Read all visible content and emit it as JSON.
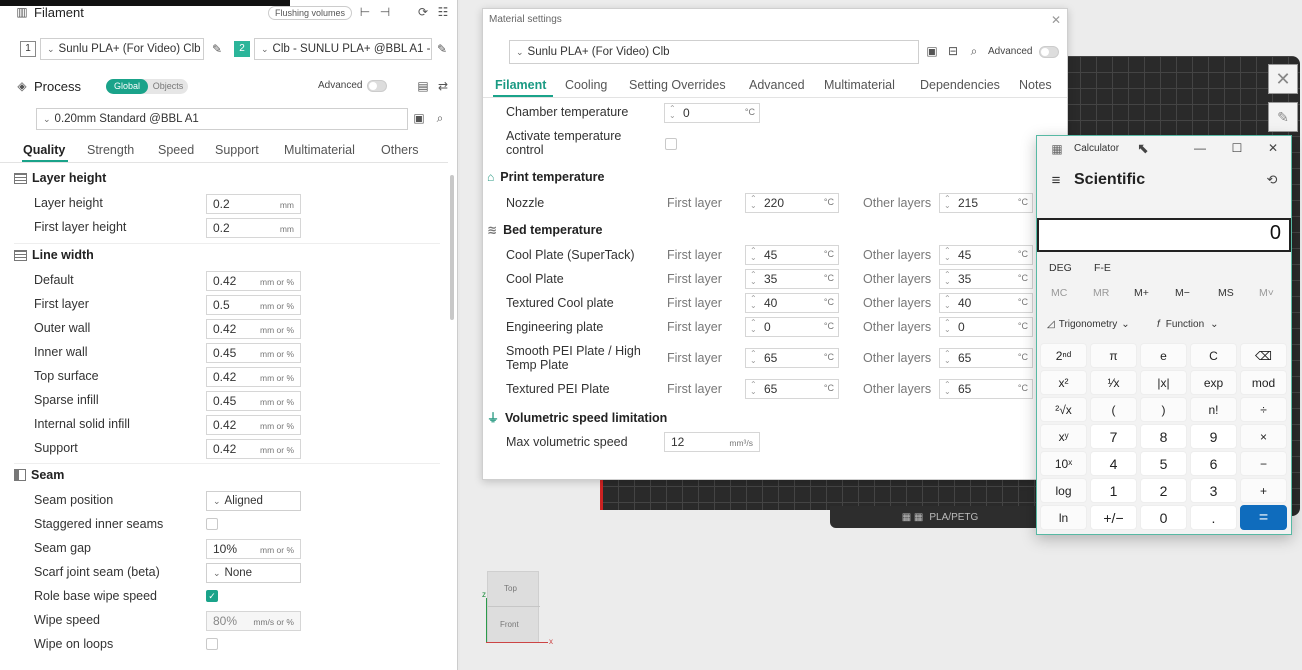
{
  "left": {
    "filament_title": "Filament",
    "flushing_volumes": "Flushing volumes",
    "filament1_index": "1",
    "filament1_name": "Sunlu PLA+ (For Video) Clb",
    "filament2_index": "2",
    "filament2_name": "Clb - SUNLU PLA+ @BBL A1 - ...",
    "process_title": "Process",
    "seg_global": "Global",
    "seg_objects": "Objects",
    "advanced": "Advanced",
    "preset": "0.20mm Standard @BBL A1",
    "tabs": [
      "Quality",
      "Strength",
      "Speed",
      "Support",
      "Multimaterial",
      "Others"
    ],
    "sections": {
      "layer_height": "Layer height",
      "line_width": "Line width",
      "seam": "Seam"
    },
    "layer_rows": [
      {
        "label": "Layer height",
        "value": "0.2",
        "unit": "mm"
      },
      {
        "label": "First layer height",
        "value": "0.2",
        "unit": "mm"
      }
    ],
    "line_rows": [
      {
        "label": "Default",
        "value": "0.42",
        "unit": "mm or %"
      },
      {
        "label": "First layer",
        "value": "0.5",
        "unit": "mm or %"
      },
      {
        "label": "Outer wall",
        "value": "0.42",
        "unit": "mm or %"
      },
      {
        "label": "Inner wall",
        "value": "0.45",
        "unit": "mm or %"
      },
      {
        "label": "Top surface",
        "value": "0.42",
        "unit": "mm or %"
      },
      {
        "label": "Sparse infill",
        "value": "0.45",
        "unit": "mm or %"
      },
      {
        "label": "Internal solid infill",
        "value": "0.42",
        "unit": "mm or %"
      },
      {
        "label": "Support",
        "value": "0.42",
        "unit": "mm or %"
      }
    ],
    "seam_rows": {
      "seam_position": "Seam position",
      "seam_position_value": "Aligned",
      "staggered": "Staggered inner seams",
      "seam_gap": "Seam gap",
      "seam_gap_value": "10%",
      "seam_gap_unit": "mm or %",
      "scarf": "Scarf joint seam (beta)",
      "scarf_value": "None",
      "role_base": "Role base wipe speed",
      "wipe_speed": "Wipe speed",
      "wipe_speed_value": "80%",
      "wipe_speed_unit": "mm/s or %",
      "wipe_loops": "Wipe on loops"
    }
  },
  "material": {
    "title": "Material settings",
    "preset": "Sunlu PLA+ (For Video) Clb",
    "advanced": "Advanced",
    "tabs": [
      "Filament",
      "Cooling",
      "Setting Overrides",
      "Advanced",
      "Multimaterial",
      "Dependencies",
      "Notes"
    ],
    "chamber_label": "Chamber temperature",
    "chamber_value": "0",
    "activate_label_1": "Activate temperature",
    "activate_label_2": "control",
    "print_temp_title": "Print temperature",
    "nozzle_label": "Nozzle",
    "first_layer": "First layer",
    "other_layers": "Other layers",
    "nozzle_first": "220",
    "nozzle_other": "215",
    "bed_temp_title": "Bed temperature",
    "bed_rows": [
      {
        "label": "Cool Plate (SuperTack)",
        "first": "45",
        "other": "45"
      },
      {
        "label": "Cool Plate",
        "first": "35",
        "other": "35"
      },
      {
        "label": "Textured Cool plate",
        "first": "40",
        "other": "40"
      },
      {
        "label": "Engineering plate",
        "first": "0",
        "other": "0"
      },
      {
        "label": "Smooth PEI Plate / High",
        "label2": "Temp Plate",
        "first": "65",
        "other": "65"
      },
      {
        "label": "Textured PEI Plate",
        "first": "65",
        "other": "65"
      }
    ],
    "deg_unit": "°C",
    "vol_title": "Volumetric speed limitation",
    "vol_label": "Max volumetric speed",
    "vol_value": "12",
    "vol_unit": "mm³/s"
  },
  "viewport": {
    "plate_label": "PLA/PETG",
    "cube_top": "Top",
    "cube_front": "Front",
    "axis_z": "z",
    "axis_x": "x"
  },
  "calculator": {
    "title": "Calculator",
    "mode": "Scientific",
    "display": "0",
    "deg": "DEG",
    "fe": "F-E",
    "memory": [
      "MC",
      "MR",
      "M+",
      "M−",
      "MS",
      "M˅"
    ],
    "trig": "Trigonometry",
    "func": "Function",
    "keys": [
      [
        "2ⁿᵈ",
        "π",
        "e",
        "C",
        "⌫"
      ],
      [
        "x²",
        "¹⁄x",
        "|x|",
        "exp",
        "mod"
      ],
      [
        "²√x",
        "(",
        ")",
        "n!",
        "÷"
      ],
      [
        "xʸ",
        "7",
        "8",
        "9",
        "×"
      ],
      [
        "10ˣ",
        "4",
        "5",
        "6",
        "−"
      ],
      [
        "log",
        "1",
        "2",
        "3",
        "+"
      ],
      [
        "ln",
        "+/−",
        "0",
        ".",
        "="
      ]
    ]
  }
}
